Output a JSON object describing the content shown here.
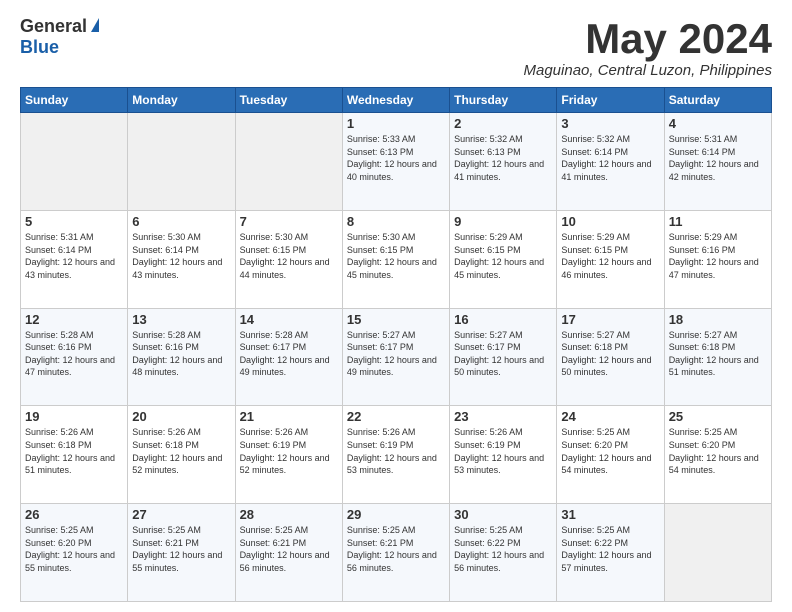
{
  "logo": {
    "general": "General",
    "blue": "Blue"
  },
  "title": "May 2024",
  "location": "Maguinao, Central Luzon, Philippines",
  "days_header": [
    "Sunday",
    "Monday",
    "Tuesday",
    "Wednesday",
    "Thursday",
    "Friday",
    "Saturday"
  ],
  "weeks": [
    [
      {
        "day": "",
        "sunrise": "",
        "sunset": "",
        "daylight": ""
      },
      {
        "day": "",
        "sunrise": "",
        "sunset": "",
        "daylight": ""
      },
      {
        "day": "",
        "sunrise": "",
        "sunset": "",
        "daylight": ""
      },
      {
        "day": "1",
        "sunrise": "Sunrise: 5:33 AM",
        "sunset": "Sunset: 6:13 PM",
        "daylight": "Daylight: 12 hours and 40 minutes."
      },
      {
        "day": "2",
        "sunrise": "Sunrise: 5:32 AM",
        "sunset": "Sunset: 6:13 PM",
        "daylight": "Daylight: 12 hours and 41 minutes."
      },
      {
        "day": "3",
        "sunrise": "Sunrise: 5:32 AM",
        "sunset": "Sunset: 6:14 PM",
        "daylight": "Daylight: 12 hours and 41 minutes."
      },
      {
        "day": "4",
        "sunrise": "Sunrise: 5:31 AM",
        "sunset": "Sunset: 6:14 PM",
        "daylight": "Daylight: 12 hours and 42 minutes."
      }
    ],
    [
      {
        "day": "5",
        "sunrise": "Sunrise: 5:31 AM",
        "sunset": "Sunset: 6:14 PM",
        "daylight": "Daylight: 12 hours and 43 minutes."
      },
      {
        "day": "6",
        "sunrise": "Sunrise: 5:30 AM",
        "sunset": "Sunset: 6:14 PM",
        "daylight": "Daylight: 12 hours and 43 minutes."
      },
      {
        "day": "7",
        "sunrise": "Sunrise: 5:30 AM",
        "sunset": "Sunset: 6:15 PM",
        "daylight": "Daylight: 12 hours and 44 minutes."
      },
      {
        "day": "8",
        "sunrise": "Sunrise: 5:30 AM",
        "sunset": "Sunset: 6:15 PM",
        "daylight": "Daylight: 12 hours and 45 minutes."
      },
      {
        "day": "9",
        "sunrise": "Sunrise: 5:29 AM",
        "sunset": "Sunset: 6:15 PM",
        "daylight": "Daylight: 12 hours and 45 minutes."
      },
      {
        "day": "10",
        "sunrise": "Sunrise: 5:29 AM",
        "sunset": "Sunset: 6:15 PM",
        "daylight": "Daylight: 12 hours and 46 minutes."
      },
      {
        "day": "11",
        "sunrise": "Sunrise: 5:29 AM",
        "sunset": "Sunset: 6:16 PM",
        "daylight": "Daylight: 12 hours and 47 minutes."
      }
    ],
    [
      {
        "day": "12",
        "sunrise": "Sunrise: 5:28 AM",
        "sunset": "Sunset: 6:16 PM",
        "daylight": "Daylight: 12 hours and 47 minutes."
      },
      {
        "day": "13",
        "sunrise": "Sunrise: 5:28 AM",
        "sunset": "Sunset: 6:16 PM",
        "daylight": "Daylight: 12 hours and 48 minutes."
      },
      {
        "day": "14",
        "sunrise": "Sunrise: 5:28 AM",
        "sunset": "Sunset: 6:17 PM",
        "daylight": "Daylight: 12 hours and 49 minutes."
      },
      {
        "day": "15",
        "sunrise": "Sunrise: 5:27 AM",
        "sunset": "Sunset: 6:17 PM",
        "daylight": "Daylight: 12 hours and 49 minutes."
      },
      {
        "day": "16",
        "sunrise": "Sunrise: 5:27 AM",
        "sunset": "Sunset: 6:17 PM",
        "daylight": "Daylight: 12 hours and 50 minutes."
      },
      {
        "day": "17",
        "sunrise": "Sunrise: 5:27 AM",
        "sunset": "Sunset: 6:18 PM",
        "daylight": "Daylight: 12 hours and 50 minutes."
      },
      {
        "day": "18",
        "sunrise": "Sunrise: 5:27 AM",
        "sunset": "Sunset: 6:18 PM",
        "daylight": "Daylight: 12 hours and 51 minutes."
      }
    ],
    [
      {
        "day": "19",
        "sunrise": "Sunrise: 5:26 AM",
        "sunset": "Sunset: 6:18 PM",
        "daylight": "Daylight: 12 hours and 51 minutes."
      },
      {
        "day": "20",
        "sunrise": "Sunrise: 5:26 AM",
        "sunset": "Sunset: 6:18 PM",
        "daylight": "Daylight: 12 hours and 52 minutes."
      },
      {
        "day": "21",
        "sunrise": "Sunrise: 5:26 AM",
        "sunset": "Sunset: 6:19 PM",
        "daylight": "Daylight: 12 hours and 52 minutes."
      },
      {
        "day": "22",
        "sunrise": "Sunrise: 5:26 AM",
        "sunset": "Sunset: 6:19 PM",
        "daylight": "Daylight: 12 hours and 53 minutes."
      },
      {
        "day": "23",
        "sunrise": "Sunrise: 5:26 AM",
        "sunset": "Sunset: 6:19 PM",
        "daylight": "Daylight: 12 hours and 53 minutes."
      },
      {
        "day": "24",
        "sunrise": "Sunrise: 5:25 AM",
        "sunset": "Sunset: 6:20 PM",
        "daylight": "Daylight: 12 hours and 54 minutes."
      },
      {
        "day": "25",
        "sunrise": "Sunrise: 5:25 AM",
        "sunset": "Sunset: 6:20 PM",
        "daylight": "Daylight: 12 hours and 54 minutes."
      }
    ],
    [
      {
        "day": "26",
        "sunrise": "Sunrise: 5:25 AM",
        "sunset": "Sunset: 6:20 PM",
        "daylight": "Daylight: 12 hours and 55 minutes."
      },
      {
        "day": "27",
        "sunrise": "Sunrise: 5:25 AM",
        "sunset": "Sunset: 6:21 PM",
        "daylight": "Daylight: 12 hours and 55 minutes."
      },
      {
        "day": "28",
        "sunrise": "Sunrise: 5:25 AM",
        "sunset": "Sunset: 6:21 PM",
        "daylight": "Daylight: 12 hours and 56 minutes."
      },
      {
        "day": "29",
        "sunrise": "Sunrise: 5:25 AM",
        "sunset": "Sunset: 6:21 PM",
        "daylight": "Daylight: 12 hours and 56 minutes."
      },
      {
        "day": "30",
        "sunrise": "Sunrise: 5:25 AM",
        "sunset": "Sunset: 6:22 PM",
        "daylight": "Daylight: 12 hours and 56 minutes."
      },
      {
        "day": "31",
        "sunrise": "Sunrise: 5:25 AM",
        "sunset": "Sunset: 6:22 PM",
        "daylight": "Daylight: 12 hours and 57 minutes."
      },
      {
        "day": "",
        "sunrise": "",
        "sunset": "",
        "daylight": ""
      }
    ]
  ]
}
